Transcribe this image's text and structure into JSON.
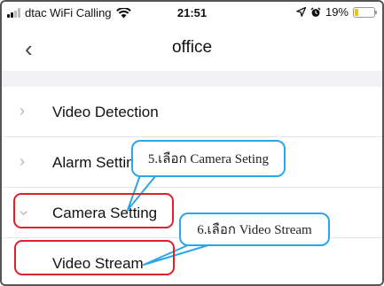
{
  "status_bar": {
    "carrier": "dtac WiFi Calling",
    "time": "21:51",
    "battery": "19%",
    "battery_level": 0.19,
    "icons": [
      "signal-icon",
      "wifi-icon",
      "location-icon",
      "alarm-icon",
      "battery-icon"
    ]
  },
  "nav": {
    "back_glyph": "‹",
    "title": "office"
  },
  "list": {
    "items": [
      {
        "label": "Video Detection"
      },
      {
        "label": "Alarm Setting"
      },
      {
        "label": "Camera Setting"
      },
      {
        "label": "Video Stream"
      }
    ]
  },
  "annotations": {
    "callout_1": "5.เลือก Camera Seting",
    "callout_2": "6.เลือก Video Stream"
  },
  "colors": {
    "highlight": "#e0202a",
    "callout_border": "#2ba7e6",
    "battery": "#f4c20d"
  }
}
